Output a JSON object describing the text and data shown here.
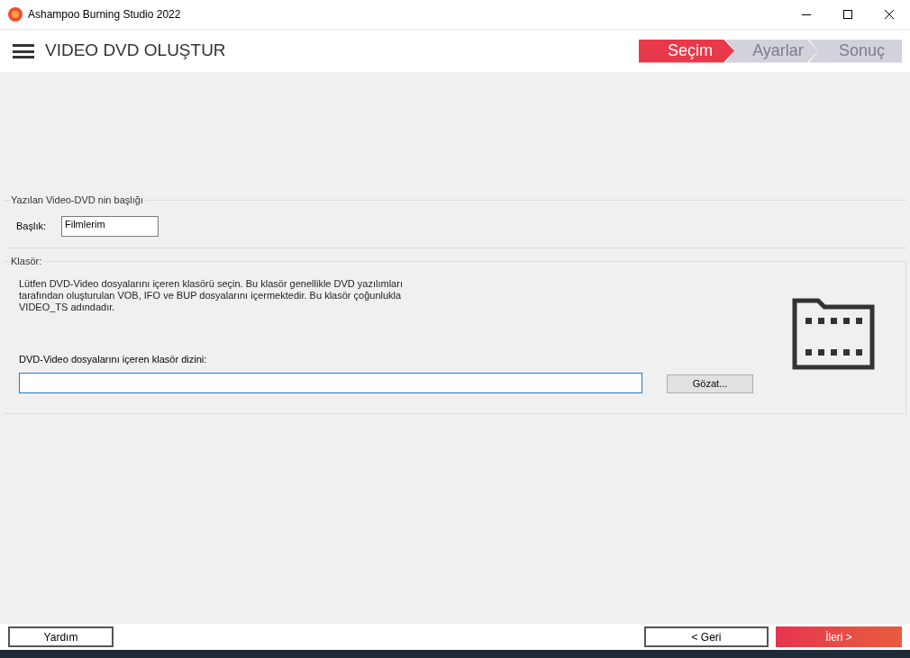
{
  "window": {
    "title": "Ashampoo Burning Studio 2022"
  },
  "header": {
    "title": "VIDEO DVD OLUŞTUR"
  },
  "steps": [
    {
      "label": "Seçim",
      "selected": true
    },
    {
      "label": "Ayarlar",
      "selected": false
    },
    {
      "label": "Sonuç",
      "selected": false
    }
  ],
  "title_group": {
    "legend": "Yazılan Video-DVD nin başlığı",
    "label": "Başlık:",
    "value": "Filmlerim"
  },
  "folder_group": {
    "legend": "Klasör:",
    "description": "Lütfen DVD-Video dosyalarını içeren klasörü seçin. Bu klasör genellikle DVD yazılımları tarafından oluşturulan VOB, IFO ve BUP dosyalarını içermektedir. Bu klasör çoğunlukla VIDEO_TS adındadır.",
    "path_label": "DVD-Video dosyalarını içeren klasör dizini:",
    "browse": "Gözat..."
  },
  "footer": {
    "help": "Yardım",
    "back": "< Geri",
    "next": "İleri >"
  }
}
